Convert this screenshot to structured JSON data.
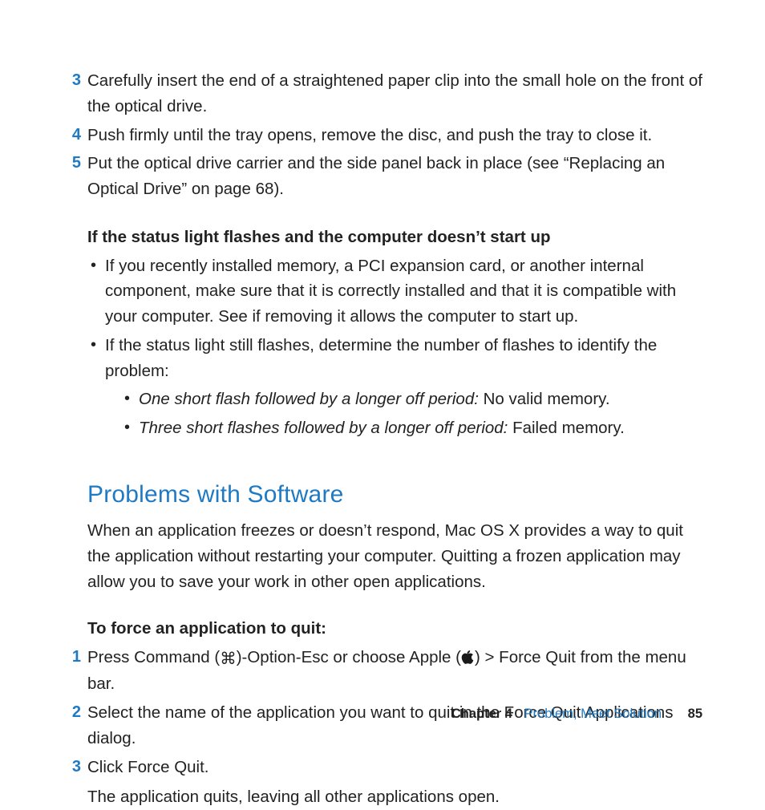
{
  "steps_a": [
    {
      "num": "3",
      "text": "Carefully insert the end of a straightened paper clip into the small hole on the front of the optical drive."
    },
    {
      "num": "4",
      "text": "Push firmly until the tray opens, remove the disc, and push the tray to close it."
    },
    {
      "num": "5",
      "text": "Put the optical drive carrier and the side panel back in place (see “Replacing an Optical Drive” on page 68)."
    }
  ],
  "status_heading": "If the status light flashes and the computer doesn’t start up",
  "status_bullets": {
    "b1": "If you recently installed memory, a PCI expansion card, or another internal component, make sure that it is correctly installed and that it is compatible with your computer. See if removing it allows the computer to start up.",
    "b2": "If the status light still flashes, determine the number of flashes to identify the problem:",
    "sub1_em": "One short flash followed by a longer off period:",
    "sub1_txt": "  No valid memory.",
    "sub2_em": "Three short flashes followed by a longer off period:",
    "sub2_txt": "  Failed memory."
  },
  "section_title": "Problems with Software",
  "section_intro": "When an application freezes or doesn’t respond, Mac OS X provides a way to quit the application without restarting your computer. Quitting a frozen application may allow you to save your work in other open applications.",
  "force_quit_heading": "To force an application to quit:",
  "steps_b": {
    "s1_pre": "Press Command (",
    "s1_mid": ")-Option-Esc or choose Apple (",
    "s1_post": ") > Force Quit from the menu bar.",
    "s2": "Select the name of the application you want to quit in the Force Quit Applications dialog.",
    "s3": "Click Force Quit."
  },
  "closing": "The application quits, leaving all other applications open.",
  "glyphs": {
    "command": "⌘"
  },
  "footer": {
    "chapter_label": "Chapter 4",
    "chapter_title": "Problem, Meet Solution",
    "page": "85"
  }
}
